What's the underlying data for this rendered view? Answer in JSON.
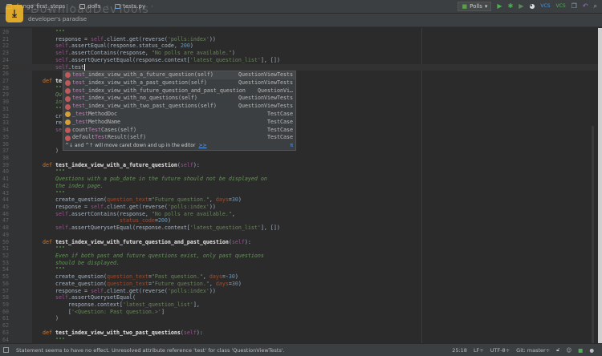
{
  "breadcrumbs": [
    "django_first_steps",
    "polls",
    "tests.py"
  ],
  "toolbar": {
    "run_config": "Polls",
    "icons": [
      "run-icon",
      "debug-icon",
      "coverage-icon",
      "profile-icon",
      "vcs-update-icon",
      "vcs-commit-icon",
      "compare-icon",
      "revert-icon",
      "search-icon"
    ]
  },
  "watermark": {
    "logo": "DownloadDevTools",
    "tagline": "developer's paradise"
  },
  "editor": {
    "current_line": 25,
    "lines": [
      {
        "n": 20,
        "t": [
          [
            "doc",
            "        \"\"\""
          ]
        ]
      },
      {
        "n": 21,
        "t": [
          [
            "p",
            "        response = "
          ],
          [
            "s",
            "self"
          ],
          [
            "p",
            ".client.get(reverse("
          ],
          [
            "str",
            "'polls:index'"
          ],
          [
            "p",
            "))"
          ]
        ]
      },
      {
        "n": 22,
        "t": [
          [
            "p",
            "        "
          ],
          [
            "s",
            "self"
          ],
          [
            "p",
            ".assertEqual(response.status_code, "
          ],
          [
            "num2",
            "200"
          ],
          [
            "p",
            ")"
          ]
        ]
      },
      {
        "n": 23,
        "t": [
          [
            "p",
            "        "
          ],
          [
            "s",
            "self"
          ],
          [
            "p",
            ".assertContains(response, "
          ],
          [
            "str",
            "\"No polls are available.\""
          ],
          [
            "p",
            ")"
          ]
        ]
      },
      {
        "n": 24,
        "t": [
          [
            "p",
            "        "
          ],
          [
            "s",
            "self"
          ],
          [
            "p",
            ".assertQuerysetEqual(response.context["
          ],
          [
            "str",
            "'latest_question_list'"
          ],
          [
            "p",
            "], [])"
          ]
        ]
      },
      {
        "n": 25,
        "t": [
          [
            "p",
            "        "
          ],
          [
            "s",
            "self"
          ],
          [
            "p",
            ".test"
          ]
        ],
        "caret": true
      },
      {
        "n": 26,
        "t": []
      },
      {
        "n": 27,
        "t": [
          [
            "k",
            "    def "
          ],
          [
            "fn",
            "te"
          ]
        ]
      },
      {
        "n": 28,
        "t": [
          [
            "doc",
            "        \"\"\""
          ]
        ]
      },
      {
        "n": 29,
        "t": [
          [
            "doc",
            "        Qu"
          ]
        ]
      },
      {
        "n": 30,
        "t": [
          [
            "doc",
            "        in"
          ]
        ]
      },
      {
        "n": 31,
        "t": [
          [
            "doc",
            "        \"\"\""
          ]
        ]
      },
      {
        "n": 32,
        "t": [
          [
            "p",
            "        cr"
          ]
        ]
      },
      {
        "n": 33,
        "t": [
          [
            "p",
            "        re"
          ]
        ]
      },
      {
        "n": 34,
        "t": [
          [
            "s",
            "        se"
          ]
        ]
      },
      {
        "n": 35,
        "t": []
      },
      {
        "n": 36,
        "t": []
      },
      {
        "n": 37,
        "t": [
          [
            "p",
            "        )"
          ]
        ]
      },
      {
        "n": 38,
        "t": []
      },
      {
        "n": 39,
        "t": [
          [
            "k",
            "    def "
          ],
          [
            "fn",
            "test_index_view_with_a_future_question"
          ],
          [
            "p",
            "("
          ],
          [
            "s",
            "self"
          ],
          [
            "p",
            "):"
          ]
        ]
      },
      {
        "n": 40,
        "t": [
          [
            "doc",
            "        \"\"\""
          ]
        ]
      },
      {
        "n": 41,
        "t": [
          [
            "doc",
            "        Questions with a pub_date in the future should not be displayed on"
          ]
        ]
      },
      {
        "n": 42,
        "t": [
          [
            "doc",
            "        the index page."
          ]
        ]
      },
      {
        "n": 43,
        "t": [
          [
            "doc",
            "        \"\"\""
          ]
        ]
      },
      {
        "n": 44,
        "t": [
          [
            "p",
            "        create_question("
          ],
          [
            "kw",
            "question_text"
          ],
          [
            "p",
            "="
          ],
          [
            "str",
            "\"Future question.\""
          ],
          [
            "p",
            ", "
          ],
          [
            "kw",
            "days"
          ],
          [
            "p",
            "="
          ],
          [
            "num2",
            "30"
          ],
          [
            "p",
            ")"
          ]
        ]
      },
      {
        "n": 45,
        "t": [
          [
            "p",
            "        response = "
          ],
          [
            "s",
            "self"
          ],
          [
            "p",
            ".client.get(reverse("
          ],
          [
            "str",
            "'polls:index'"
          ],
          [
            "p",
            "))"
          ]
        ]
      },
      {
        "n": 46,
        "t": [
          [
            "p",
            "        "
          ],
          [
            "s",
            "self"
          ],
          [
            "p",
            ".assertContains(response, "
          ],
          [
            "str",
            "\"No polls are available.\""
          ],
          [
            "p",
            ","
          ]
        ]
      },
      {
        "n": 47,
        "t": [
          [
            "p",
            "                            "
          ],
          [
            "kw",
            "status_code"
          ],
          [
            "p",
            "="
          ],
          [
            "num2",
            "200"
          ],
          [
            "p",
            ")"
          ]
        ]
      },
      {
        "n": 48,
        "t": [
          [
            "p",
            "        "
          ],
          [
            "s",
            "self"
          ],
          [
            "p",
            ".assertQuerysetEqual(response.context["
          ],
          [
            "str",
            "'latest_question_list'"
          ],
          [
            "p",
            "], [])"
          ]
        ]
      },
      {
        "n": 49,
        "t": []
      },
      {
        "n": 50,
        "t": [
          [
            "k",
            "    def "
          ],
          [
            "fn",
            "test_index_view_with_future_question_and_past_question"
          ],
          [
            "p",
            "("
          ],
          [
            "s",
            "self"
          ],
          [
            "p",
            "):"
          ]
        ]
      },
      {
        "n": 51,
        "t": [
          [
            "doc",
            "        \"\"\""
          ]
        ]
      },
      {
        "n": 52,
        "t": [
          [
            "doc",
            "        Even if both past and future questions exist, only past questions"
          ]
        ]
      },
      {
        "n": 53,
        "t": [
          [
            "doc",
            "        should be displayed."
          ]
        ]
      },
      {
        "n": 54,
        "t": [
          [
            "doc",
            "        \"\"\""
          ]
        ]
      },
      {
        "n": 55,
        "t": [
          [
            "p",
            "        create_question("
          ],
          [
            "kw",
            "question_text"
          ],
          [
            "p",
            "="
          ],
          [
            "str",
            "\"Past question.\""
          ],
          [
            "p",
            ", "
          ],
          [
            "kw",
            "days"
          ],
          [
            "p",
            "=-"
          ],
          [
            "num2",
            "30"
          ],
          [
            "p",
            ")"
          ]
        ]
      },
      {
        "n": 56,
        "t": [
          [
            "p",
            "        create_question("
          ],
          [
            "kw",
            "question_text"
          ],
          [
            "p",
            "="
          ],
          [
            "str",
            "\"Future question.\""
          ],
          [
            "p",
            ", "
          ],
          [
            "kw",
            "days"
          ],
          [
            "p",
            "="
          ],
          [
            "num2",
            "30"
          ],
          [
            "p",
            ")"
          ]
        ]
      },
      {
        "n": 57,
        "t": [
          [
            "p",
            "        response = "
          ],
          [
            "s",
            "self"
          ],
          [
            "p",
            ".client.get(reverse("
          ],
          [
            "str",
            "'polls:index'"
          ],
          [
            "p",
            "))"
          ]
        ]
      },
      {
        "n": 58,
        "t": [
          [
            "p",
            "        "
          ],
          [
            "s",
            "self"
          ],
          [
            "p",
            ".assertQuerysetEqual("
          ]
        ]
      },
      {
        "n": 59,
        "t": [
          [
            "p",
            "            response.context["
          ],
          [
            "str",
            "'latest_question_list'"
          ],
          [
            "p",
            "],"
          ]
        ]
      },
      {
        "n": 60,
        "t": [
          [
            "p",
            "            ["
          ],
          [
            "str",
            "'<Question: Past question.>'"
          ],
          [
            "p",
            "]"
          ]
        ]
      },
      {
        "n": 61,
        "t": [
          [
            "p",
            "        )"
          ]
        ]
      },
      {
        "n": 62,
        "t": []
      },
      {
        "n": 63,
        "t": [
          [
            "k",
            "    def "
          ],
          [
            "fn",
            "test_index_view_with_two_past_questions"
          ],
          [
            "p",
            "("
          ],
          [
            "s",
            "self"
          ],
          [
            "p",
            "):"
          ]
        ]
      },
      {
        "n": 64,
        "t": [
          [
            "doc",
            "        \"\"\""
          ]
        ]
      }
    ]
  },
  "completion": {
    "items": [
      {
        "pre": "",
        "match": "test",
        "rest": "_index_view_with_a_future_question(self)",
        "cls": "QuestionViewTests",
        "icon": "method-icon"
      },
      {
        "pre": "",
        "match": "test",
        "rest": "_index_view_with_a_past_question(self)",
        "cls": "QuestionViewTests",
        "icon": "method-icon"
      },
      {
        "pre": "",
        "match": "test",
        "rest": "_index_view_with_future_question_and_past_question",
        "cls": "QuestionVi…",
        "icon": "method-icon"
      },
      {
        "pre": "",
        "match": "test",
        "rest": "_index_view_with_no_questions(self)",
        "cls": "QuestionViewTests",
        "icon": "method-icon"
      },
      {
        "pre": "",
        "match": "test",
        "rest": "_index_view_with_two_past_questions(self)",
        "cls": "QuestionViewTests",
        "icon": "method-icon"
      },
      {
        "pre": "_",
        "match": "test",
        "rest": "MethodDoc",
        "cls": "TestCase",
        "icon": "field-icon"
      },
      {
        "pre": "_",
        "match": "test",
        "rest": "MethodName",
        "cls": "TestCase",
        "icon": "field-icon"
      },
      {
        "pre": "count",
        "match": "Test",
        "rest": "Cases(self)",
        "cls": "TestCase",
        "icon": "method-icon"
      },
      {
        "pre": "default",
        "match": "Test",
        "rest": "Result(self)",
        "cls": "TestCase",
        "icon": "method-icon"
      }
    ],
    "hint": "^↓ and ^↑ will move caret down and up in the editor",
    "hint_link": ">>",
    "pi": "π"
  },
  "status": {
    "message": "Statement seems to have no effect. Unresolved attribute reference 'test' for class 'QuestionViewTests'.",
    "position": "25:18",
    "line_sep": "LF÷",
    "encoding": "UTF-8÷",
    "vcs": "Git: master÷"
  }
}
